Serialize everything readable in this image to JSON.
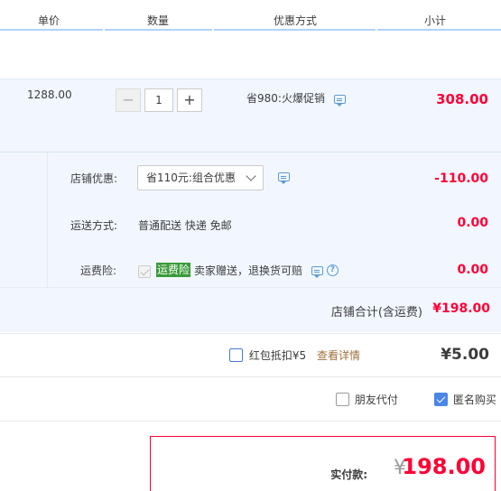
{
  "header": {
    "col_price": "单价",
    "col_qty": "数量",
    "col_promo": "优惠方式",
    "col_subtotal": "小计"
  },
  "item": {
    "unit_price": "1288.00",
    "qty_minus": "−",
    "qty_value": "1",
    "qty_plus": "+",
    "promo": "省980:火爆促销",
    "subtotal": "308.00"
  },
  "shop": {
    "discount_label": "店铺优惠:",
    "discount_select": "省110元:组合优惠",
    "discount_value": "-110.00",
    "shipping_label": "运送方式:",
    "shipping_text": "普通配送 快递 免邮",
    "shipping_value": "0.00",
    "insurance_label": "运费险:",
    "insurance_tag": "运费险",
    "insurance_text": "卖家赠送，退换货可赔",
    "insurance_value": "0.00",
    "total_label": "店铺合计(含运费)",
    "total_value": "¥198.00"
  },
  "hongbao": {
    "label": "红包抵扣¥5",
    "link": "查看详情",
    "amount": "¥5.00"
  },
  "options": {
    "friend_pay": "朋友代付",
    "anonymous": "匿名购买",
    "friend_pay_checked": false,
    "anonymous_checked": true
  },
  "payment": {
    "label": "实付款:",
    "currency": "¥",
    "amount": "198.00"
  },
  "colors": {
    "accent_red": "#ff0036",
    "header_line": "#b2d1ff",
    "row_bg": "#f2f7ff",
    "insurance_green": "#3a9b3a",
    "checkbox_blue": "#4a86e8"
  }
}
